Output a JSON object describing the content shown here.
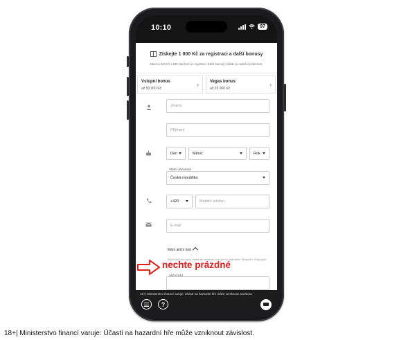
{
  "status": {
    "time": "10:10",
    "battery": "97"
  },
  "promo": {
    "title": "Získejte 1 000 Kč za registraci a další bonusy",
    "subtitle": "Zdarma 500 Kč a 500 zatočení po registraci. Další bonusy získáte po splnění podmínek."
  },
  "bonuses": [
    {
      "title": "Vstupní bonus",
      "subtitle": "až 50 000 Kč"
    },
    {
      "title": "Vegas bonus",
      "subtitle": "až 25 000 Kč"
    }
  ],
  "form": {
    "first_name_placeholder": "Jméno",
    "last_name_placeholder": "Příjmení",
    "day_label": "Den",
    "month_label": "Měsíc",
    "year_label": "Rok",
    "citizenship_label": "Státní občanství",
    "citizenship_value": "Česká republika",
    "phone_prefix": "+420",
    "phone_placeholder": "Mobilní telefon",
    "email_placeholder": "E-mail",
    "promo_toggle_label": "Mám akční kód",
    "promo_help": "Akční kód pro nové účasti se většinou dozvíte na stránkách Tipsportu. Kódy jsou časově omezené.",
    "promo_code_label": "Akční kód"
  },
  "bottom": {
    "warning": "18+| Ministerstvo financí varuje: Účastí na hazardní hře může vzniknout závislost."
  },
  "annotation": {
    "text": "nechte prázdné",
    "color": "#e0201b"
  },
  "footer": {
    "text": "18+| Ministerstvo financí varuje: Účastí na hazardní hře může vzniknout závislost."
  }
}
